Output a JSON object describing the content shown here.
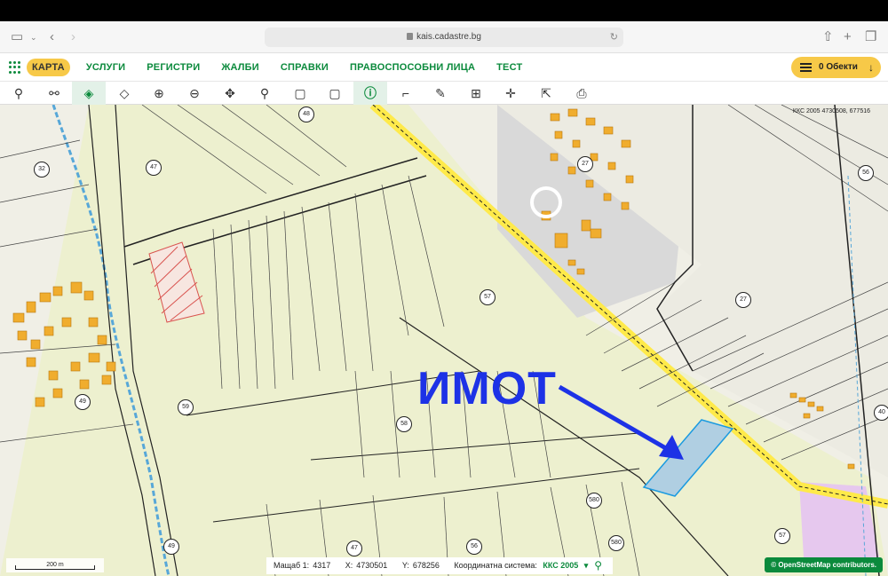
{
  "browser": {
    "url": "kais.cadastre.bg"
  },
  "nav": {
    "items": [
      {
        "label": "КАРТА",
        "active": true
      },
      {
        "label": "УСЛУГИ"
      },
      {
        "label": "РЕГИСТРИ"
      },
      {
        "label": "ЖАЛБИ"
      },
      {
        "label": "СПРАВКИ"
      },
      {
        "label": "ПРАВОСПОСОБНИ ЛИЦА"
      },
      {
        "label": "ТЕСТ"
      }
    ],
    "objects_label": "0 Обекти"
  },
  "toolbar": {
    "tools": [
      "search-icon",
      "route-icon",
      "layers-active-icon",
      "layers-icon",
      "zoom-in-icon",
      "zoom-out-icon",
      "pan-icon",
      "location-pin-icon",
      "rectangle-select-icon",
      "rectangle-deselect-icon",
      "info-icon",
      "measure-icon",
      "draw-icon",
      "map-icon",
      "crosshair-icon",
      "export-icon",
      "print-icon"
    ]
  },
  "map": {
    "top_coords": "ККС 2005 4730508, 677516",
    "annotation": "ИМОТ",
    "parcel_labels": [
      "48",
      "47",
      "32",
      "27",
      "57",
      "27",
      "49",
      "59",
      "58",
      "40",
      "580",
      "580",
      "56",
      "47",
      "49",
      "57",
      "56"
    ]
  },
  "status": {
    "scale_label": "Мащаб 1:",
    "scale_value": "4317",
    "x_label": "X:",
    "x_value": "4730501",
    "y_label": "Y:",
    "y_value": "678256",
    "crs_label": "Координатна система:",
    "crs_value": "ККС 2005"
  },
  "scale_bar": "200 m",
  "attribution": "© OpenStreetMap contributors."
}
